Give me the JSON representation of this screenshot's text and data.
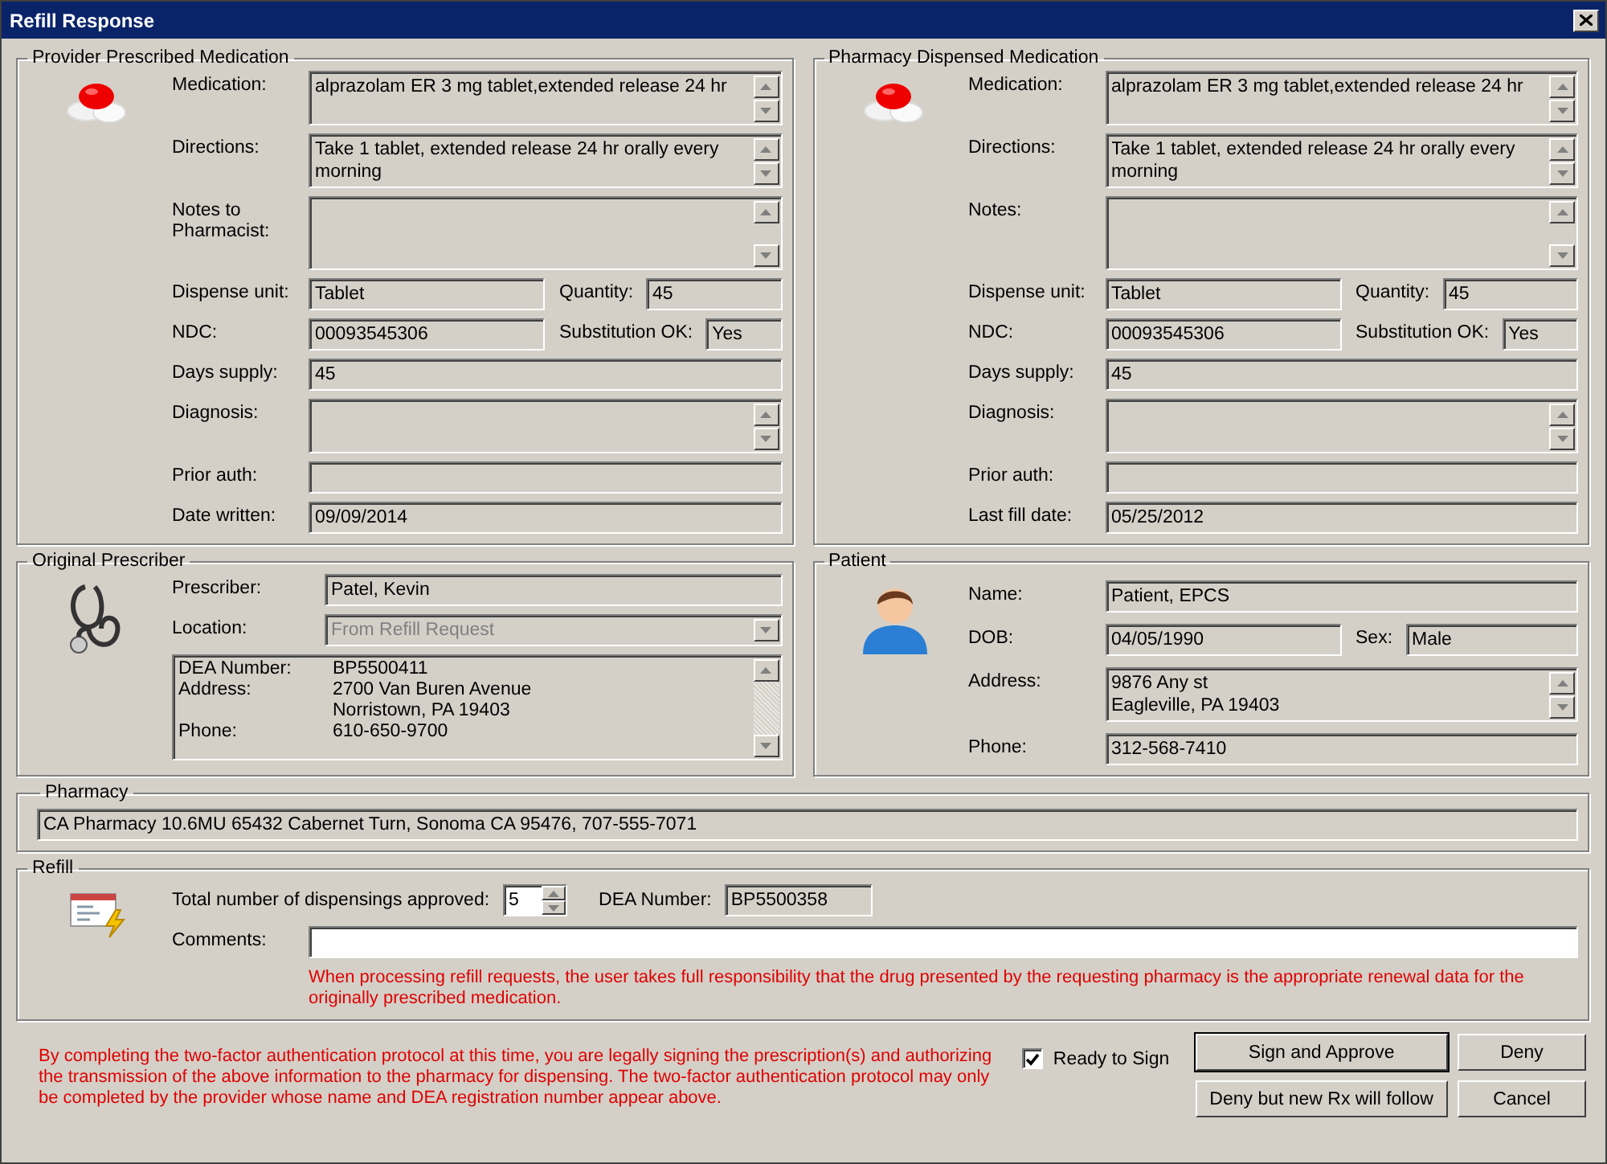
{
  "window": {
    "title": "Refill Response"
  },
  "provider_medication": {
    "title": "Provider Prescribed Medication",
    "rows": [
      {
        "kind": "memo",
        "label": "Medication:",
        "value": "alprazolam ER 3 mg tablet,extended release 24 hr"
      },
      {
        "kind": "memo",
        "label": "Directions:",
        "value": "Take 1 tablet, extended release 24 hr orally every morning"
      },
      {
        "kind": "memo_tall",
        "label": "Notes to Pharmacist:"
      },
      {
        "kind": "pair",
        "label": "Dispense unit:",
        "value": "Tablet",
        "label2": "Quantity:",
        "value2": "45"
      },
      {
        "kind": "pair",
        "label": "NDC:",
        "value": "00093545306",
        "label2": "Substitution OK:",
        "value2": "Yes"
      },
      {
        "kind": "text",
        "label": "Days supply:",
        "value": "45"
      },
      {
        "kind": "memo",
        "label": "Diagnosis:"
      },
      {
        "kind": "text",
        "label": "Prior auth:"
      },
      {
        "kind": "text",
        "label": "Date written:",
        "value": "09/09/2014"
      }
    ]
  },
  "pharmacy_medication": {
    "title": "Pharmacy Dispensed Medication",
    "rows": [
      {
        "kind": "memo",
        "label": "Medication:",
        "value": "alprazolam ER 3 mg tablet,extended release 24 hr"
      },
      {
        "kind": "memo",
        "label": "Directions:",
        "value": "Take 1 tablet, extended release 24 hr orally every morning"
      },
      {
        "kind": "memo_tall",
        "label": "Notes:"
      },
      {
        "kind": "pair",
        "label": "Dispense unit:",
        "value": "Tablet",
        "label2": "Quantity:",
        "value2": "45"
      },
      {
        "kind": "pair",
        "label": "NDC:",
        "value": "00093545306",
        "label2": "Substitution OK:",
        "value2": "Yes"
      },
      {
        "kind": "text",
        "label": "Days supply:",
        "value": "45"
      },
      {
        "kind": "memo",
        "label": "Diagnosis:"
      },
      {
        "kind": "text",
        "label": "Prior auth:"
      },
      {
        "kind": "text",
        "label": "Last fill date:",
        "value": "05/25/2012"
      }
    ]
  },
  "original_prescriber": {
    "title": "Original Prescriber",
    "rows": [
      {
        "kind": "text",
        "label": "Prescriber:",
        "value": "Patel, Kevin"
      },
      {
        "kind": "combo",
        "label": "Location:",
        "value": "From Refill Request",
        "disabled": true
      }
    ],
    "details": [
      {
        "label": "DEA Number:",
        "value": "BP5500411"
      },
      {
        "label": "Address:",
        "value": "2700 Van Buren Avenue"
      },
      {
        "value": "Norristown, PA 19403"
      },
      {
        "label": "Phone:",
        "value": "610-650-9700"
      }
    ]
  },
  "patient": {
    "title": "Patient",
    "rows": [
      {
        "kind": "text",
        "label": "Name:",
        "value": "Patient, EPCS"
      },
      {
        "kind": "pair",
        "label": "DOB:",
        "value": "04/05/1990",
        "label2": "Sex:",
        "value2": "Male"
      },
      {
        "kind": "memo",
        "label": "Address:",
        "lines": [
          "9876 Any st",
          "Eagleville, PA 19403"
        ]
      },
      {
        "kind": "text",
        "label": "Phone:",
        "value": "312-568-7410"
      }
    ]
  },
  "pharmacy": {
    "title": "Pharmacy",
    "value": "CA Pharmacy 10.6MU 65432 Cabernet Turn, Sonoma CA 95476, 707-555-7071"
  },
  "refill": {
    "title": "Refill",
    "dispensings_label": "Total number of dispensings approved:",
    "dispensings": "5",
    "dea_label": "DEA Number:",
    "dea": "BP5500358",
    "comments_label": "Comments:",
    "warning": "When processing refill requests, the user takes full responsibility that the drug presented by the requesting pharmacy is the appropriate renewal data for the originally prescribed medication."
  },
  "footer": {
    "notice": "By completing the two-factor authentication protocol at this time, you are legally signing the prescription(s) and authorizing the transmission of the above information to the pharmacy for dispensing.  The two-factor authentication protocol may only be completed by the provider whose name and DEA registration number appear above.",
    "ready": {
      "label": "Ready to Sign",
      "checked": true
    },
    "buttons": [
      {
        "label": "Sign and Approve",
        "default": true
      },
      {
        "label": "Deny",
        "default": false
      },
      {
        "label": "Deny but new Rx will follow",
        "default": false
      },
      {
        "label": "Cancel",
        "default": false
      }
    ]
  }
}
